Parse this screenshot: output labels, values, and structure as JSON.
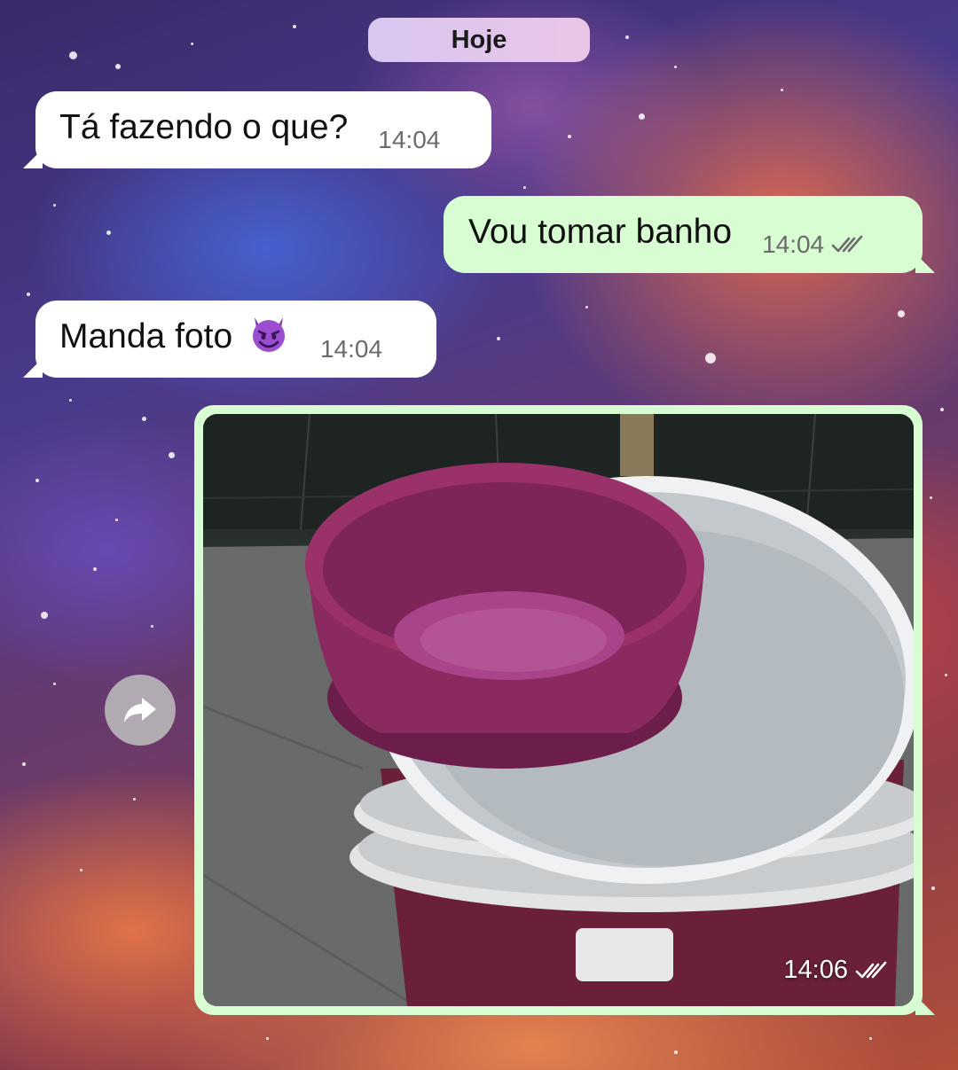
{
  "date_separator": {
    "label": "Hoje"
  },
  "messages": [
    {
      "direction": "in",
      "text": "Tá fazendo o que?",
      "time": "14:04"
    },
    {
      "direction": "out",
      "text": "Vou tomar banho",
      "time": "14:04",
      "status": "read"
    },
    {
      "direction": "in",
      "text": "Manda foto",
      "emoji": "smiling-devil",
      "time": "14:04"
    },
    {
      "direction": "out",
      "type": "image",
      "image_content": "purple plastic basin stacked on white buckets",
      "time": "14:06",
      "status": "read"
    }
  ],
  "colors": {
    "incoming_bubble": "#ffffff",
    "outgoing_bubble": "#d9fdd3",
    "date_pill": "#dcc6ee",
    "timestamp": "#6b6b6b"
  },
  "icons": {
    "forward": "forward-arrow-icon",
    "read_receipt": "double-check-icon"
  }
}
